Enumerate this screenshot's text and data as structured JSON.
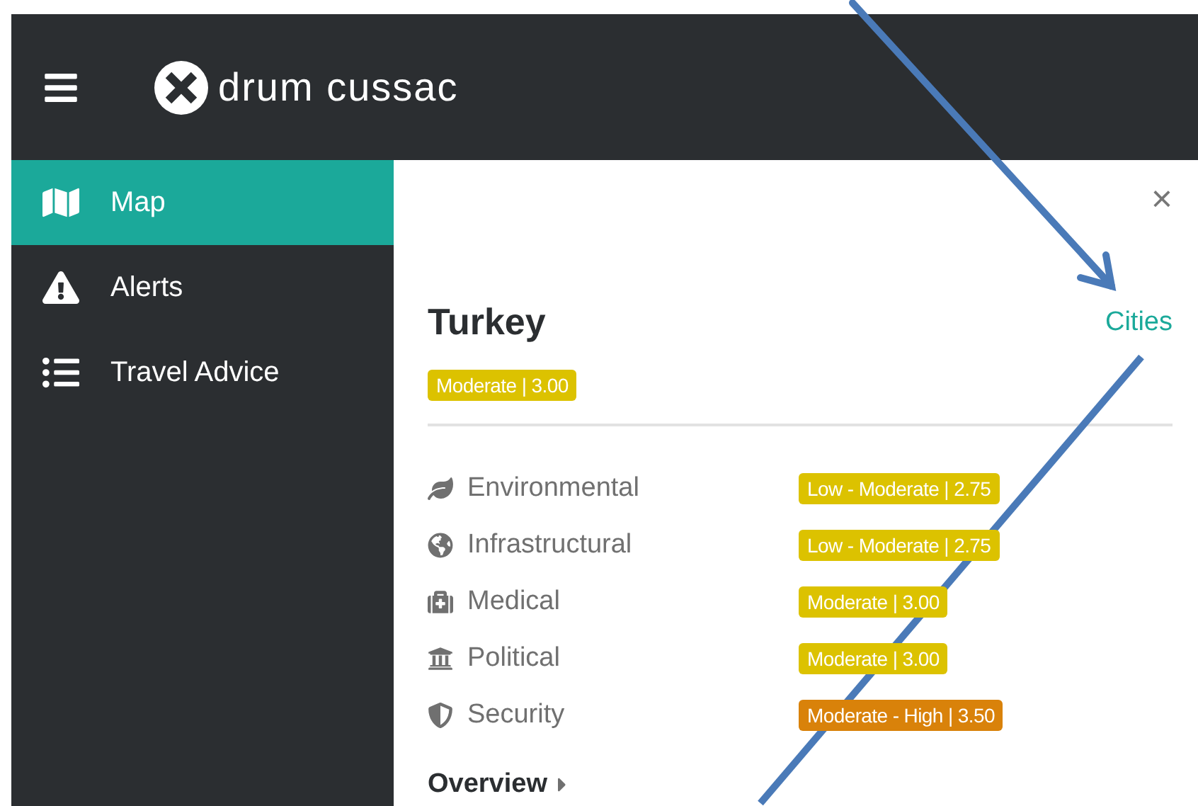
{
  "header": {
    "brand": "drum cussac"
  },
  "sidebar": {
    "items": [
      {
        "label": "Map",
        "selected": true
      },
      {
        "label": "Alerts",
        "selected": false
      },
      {
        "label": "Travel Advice",
        "selected": false
      }
    ]
  },
  "panel": {
    "close": "×",
    "title": "Turkey",
    "link": "Cities",
    "overall": {
      "text": "Moderate | 3.00",
      "color": "#dcc200"
    },
    "risks": [
      {
        "label": "Environmental",
        "rating": "Low - Moderate | 2.75",
        "color": "#dcc200"
      },
      {
        "label": "Infrastructural",
        "rating": "Low - Moderate | 2.75",
        "color": "#dcc200"
      },
      {
        "label": "Medical",
        "rating": "Moderate | 3.00",
        "color": "#dcc200"
      },
      {
        "label": "Political",
        "rating": "Moderate | 3.00",
        "color": "#dcc200"
      },
      {
        "label": "Security",
        "rating": "Moderate - High | 3.50",
        "color": "#d9820a"
      }
    ],
    "section": "Overview"
  }
}
